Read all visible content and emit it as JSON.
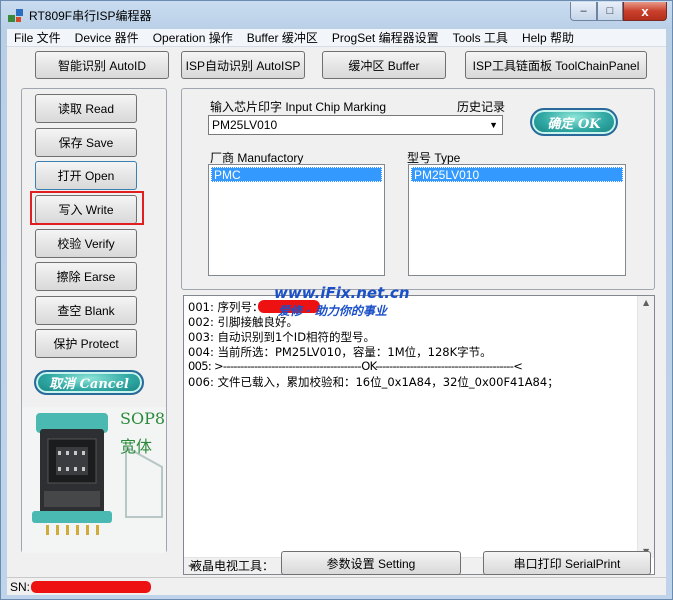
{
  "window": {
    "title": "RT809F串行ISP编程器",
    "controls": {
      "minimize": "–",
      "maximize": "□",
      "close": "x"
    }
  },
  "menu": [
    "File 文件",
    "Device 器件",
    "Operation 操作",
    "Buffer 缓冲区",
    "ProgSet 编程器设置",
    "Tools 工具",
    "Help 帮助"
  ],
  "toolbar": {
    "autoid": "智能识别 AutoID",
    "autoisp": "ISP自动识别 AutoISP",
    "buffer": "缓冲区 Buffer",
    "toolchain": "ISP工具链面板 ToolChainPanel"
  },
  "side_buttons": {
    "read": "读取 Read",
    "save": "保存 Save",
    "open": "打开 Open",
    "write": "写入 Write",
    "verify": "校验 Verify",
    "erase": "擦除 Earse",
    "blank": "查空 Blank",
    "protect": "保护 Protect",
    "cancel": "取消 Cancel"
  },
  "chip": {
    "marking_label": "输入芯片印字 Input Chip Marking",
    "history_label": "历史记录",
    "marking_value": "PM25LV010",
    "ok_label": "确定 OK",
    "manufactory_label": "厂商 Manufactory",
    "type_label": "型号 Type",
    "manufactory_selected": "PMC",
    "type_selected": "PM25LV010"
  },
  "socket_image": {
    "caption_line1": "SOP8",
    "caption_line2": "宽体"
  },
  "log": [
    "001: 序列号：",
    "002: 引脚接触良好。",
    "003: 自动识别到1个ID相符的型号。",
    "004: 当前所选：PM25LV010，容量：1M位，128K字节。",
    "005: >----------------------------------------OK----------------------------------------<",
    "006: 文件已载入，累加校验和：16位_0x1A84，32位_0x00F41A84；"
  ],
  "watermark": {
    "line1": "www.iFix.net.cn",
    "line2": "爱修 · 助力你的事业"
  },
  "bottom": {
    "lcd_label": "液晶电视工具：",
    "setting": "参数设置 Setting",
    "serialprint": "串口打印 SerialPrint"
  },
  "status": {
    "sn_label": "SN:"
  },
  "colors": {
    "highlight_box": "#e02020",
    "redaction": "#ee1111",
    "selection": "#3399ff",
    "ok_button": "#2fa7a3"
  }
}
